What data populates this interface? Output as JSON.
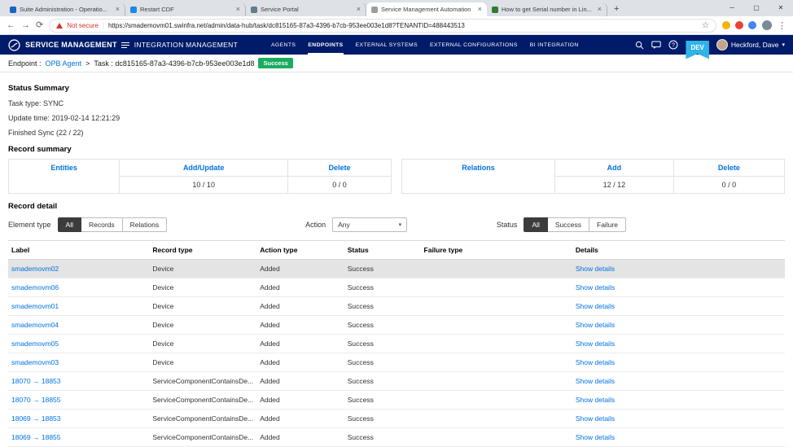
{
  "colors": {
    "brand": "#001b69",
    "link": "#0073e7",
    "success": "#1aac60",
    "env": "#30b4e8",
    "warning": "#d93025",
    "seg_active": "#3c3c3c",
    "row_highlight": "#e4e4e4"
  },
  "browser": {
    "tabs": [
      {
        "title": "Suite Administration - Operatio...",
        "active": false,
        "favicon_color": "#1565c0"
      },
      {
        "title": "Restart CDF",
        "active": false,
        "favicon_color": "#1e88e5"
      },
      {
        "title": "Service Portal",
        "active": false,
        "favicon_color": "#607d8b"
      },
      {
        "title": "Service Management Automation",
        "active": true,
        "favicon_color": "#9e9e9e"
      },
      {
        "title": "How to get Serial number in Lin...",
        "active": false,
        "favicon_color": "#2e7d32"
      }
    ],
    "glyphs": {
      "back": "←",
      "forward": "→",
      "refresh": "⟳",
      "star": "☆",
      "menu_dots": "⋮",
      "minimize": "─",
      "maximize": "▢",
      "close": "✕",
      "new_tab": "+",
      "tab_close": "×",
      "chevron_down": "▾",
      "breadcrumb_sep": ">"
    },
    "address": {
      "security_label": "Not secure",
      "url": "https://smademovm01.swinfra.net/admin/data-hub/task/dc815165-87a3-4396-b7cb-953ee003e1d8?TENANTID=488443513"
    },
    "extension_icon_colors": [
      "#f4b400",
      "#ea4335",
      "#4285f4"
    ]
  },
  "app_header": {
    "brand": "SERVICE MANAGEMENT",
    "module": "INTEGRATION MANAGEMENT",
    "nav": [
      {
        "label": "AGENTS",
        "active": false
      },
      {
        "label": "ENDPOINTS",
        "active": true
      },
      {
        "label": "EXTERNAL SYSTEMS",
        "active": false
      },
      {
        "label": "EXTERNAL CONFIGURATIONS",
        "active": false
      },
      {
        "label": "BI INTEGRATION",
        "active": false
      }
    ],
    "env_badge": "DEV",
    "user_name": "Heckford, Dave"
  },
  "breadcrumb": {
    "prefix": "Endpoint :",
    "endpoint_link": "OPB Agent",
    "task_label": "Task : dc815165-87a3-4396-b7cb-953ee003e1d8",
    "status_badge": "Success"
  },
  "status_summary": {
    "title": "Status Summary",
    "lines": [
      "Task type: SYNC",
      "Update time: 2019-02-14 12:21:29",
      "Finished Sync (22 / 22)"
    ]
  },
  "record_summary": {
    "title": "Record summary",
    "entities_table": {
      "group_header": "Entities",
      "col_headers": [
        "Add/Update",
        "Delete"
      ],
      "values": [
        "10 / 10",
        "0 / 0"
      ]
    },
    "relations_table": {
      "group_header": "Relations",
      "col_headers": [
        "Add",
        "Delete"
      ],
      "values": [
        "12 / 12",
        "0 / 0"
      ]
    }
  },
  "record_detail": {
    "title": "Record detail",
    "element_type_label": "Element type",
    "element_type_options": [
      "All",
      "Records",
      "Relations"
    ],
    "element_type_selected": "All",
    "action_label": "Action",
    "action_value": "Any",
    "status_label": "Status",
    "status_options": [
      "All",
      "Success",
      "Failure"
    ],
    "status_selected": "All",
    "table": {
      "headers": [
        "Label",
        "Record type",
        "Action type",
        "Status",
        "Failure type",
        "Details"
      ],
      "details_label": "Show details",
      "rows": [
        {
          "label": "smademovm02",
          "record_type": "Device",
          "action_type": "Added",
          "status": "Success",
          "failure_type": "",
          "highlighted": true
        },
        {
          "label": "smademovm06",
          "record_type": "Device",
          "action_type": "Added",
          "status": "Success",
          "failure_type": "",
          "highlighted": false
        },
        {
          "label": "smademovm01",
          "record_type": "Device",
          "action_type": "Added",
          "status": "Success",
          "failure_type": "",
          "highlighted": false
        },
        {
          "label": "smademovm04",
          "record_type": "Device",
          "action_type": "Added",
          "status": "Success",
          "failure_type": "",
          "highlighted": false
        },
        {
          "label": "smademovm05",
          "record_type": "Device",
          "action_type": "Added",
          "status": "Success",
          "failure_type": "",
          "highlighted": false
        },
        {
          "label": "smademovm03",
          "record_type": "Device",
          "action_type": "Added",
          "status": "Success",
          "failure_type": "",
          "highlighted": false
        },
        {
          "label": "18070 → 18853",
          "record_type": "ServiceComponentContainsDe...",
          "action_type": "Added",
          "status": "Success",
          "failure_type": "",
          "highlighted": false
        },
        {
          "label": "18070 → 18855",
          "record_type": "ServiceComponentContainsDe...",
          "action_type": "Added",
          "status": "Success",
          "failure_type": "",
          "highlighted": false
        },
        {
          "label": "18069 → 18853",
          "record_type": "ServiceComponentContainsDe...",
          "action_type": "Added",
          "status": "Success",
          "failure_type": "",
          "highlighted": false
        },
        {
          "label": "18069 → 18855",
          "record_type": "ServiceComponentContainsDe...",
          "action_type": "Added",
          "status": "Success",
          "failure_type": "",
          "highlighted": false
        }
      ]
    }
  }
}
